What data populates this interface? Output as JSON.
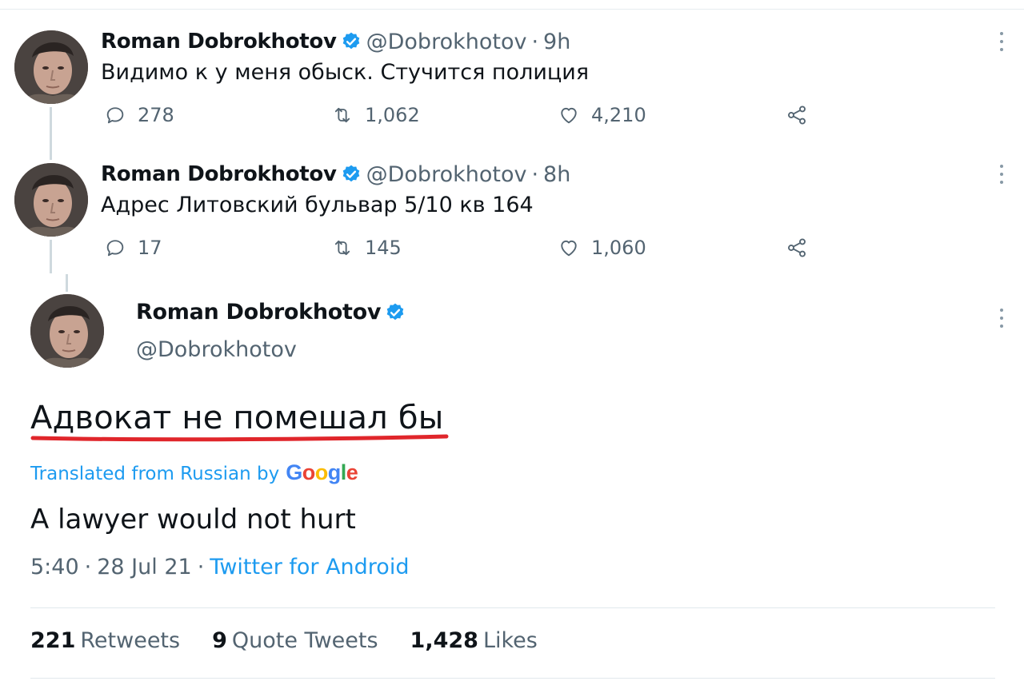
{
  "tweets": [
    {
      "name": "Roman Dobrokhotov",
      "handle": "@Dobrokhotov",
      "time": "9h",
      "text": "Видимо к у меня обыск. Стучится полиция",
      "replies": "278",
      "retweets": "1,062",
      "likes": "4,210"
    },
    {
      "name": "Roman Dobrokhotov",
      "handle": "@Dobrokhotov",
      "time": "8h",
      "text": "Адрес Литовский бульвар 5/10 кв 164",
      "replies": "17",
      "retweets": "145",
      "likes": "1,060"
    }
  ],
  "main": {
    "name": "Roman Dobrokhotov",
    "handle": "@Dobrokhotov",
    "text": "Адвокат не помешал бы",
    "translated_prefix": "Translated from Russian by",
    "google_letters": [
      "G",
      "o",
      "o",
      "g",
      "l",
      "e"
    ],
    "translation": "A lawyer would not hurt",
    "time": "5:40",
    "date": "28 Jul 21",
    "source": "Twitter for Android",
    "meta_sep": "·"
  },
  "stats": [
    {
      "num": "221",
      "label": "Retweets"
    },
    {
      "num": "9",
      "label": "Quote Tweets"
    },
    {
      "num": "1,428",
      "label": "Likes"
    }
  ],
  "sep": "·",
  "colors": {
    "accent": "#1d9bf0",
    "underline": "#e0262b",
    "google": [
      "#4285f4",
      "#ea4335",
      "#fbbc05",
      "#4285f4",
      "#34a853",
      "#ea4335"
    ]
  },
  "icons": {
    "verified": "verified-badge-icon",
    "reply": "reply-icon",
    "retweet": "retweet-icon",
    "like": "heart-icon",
    "share": "share-icon",
    "more": "more-vertical-icon"
  }
}
